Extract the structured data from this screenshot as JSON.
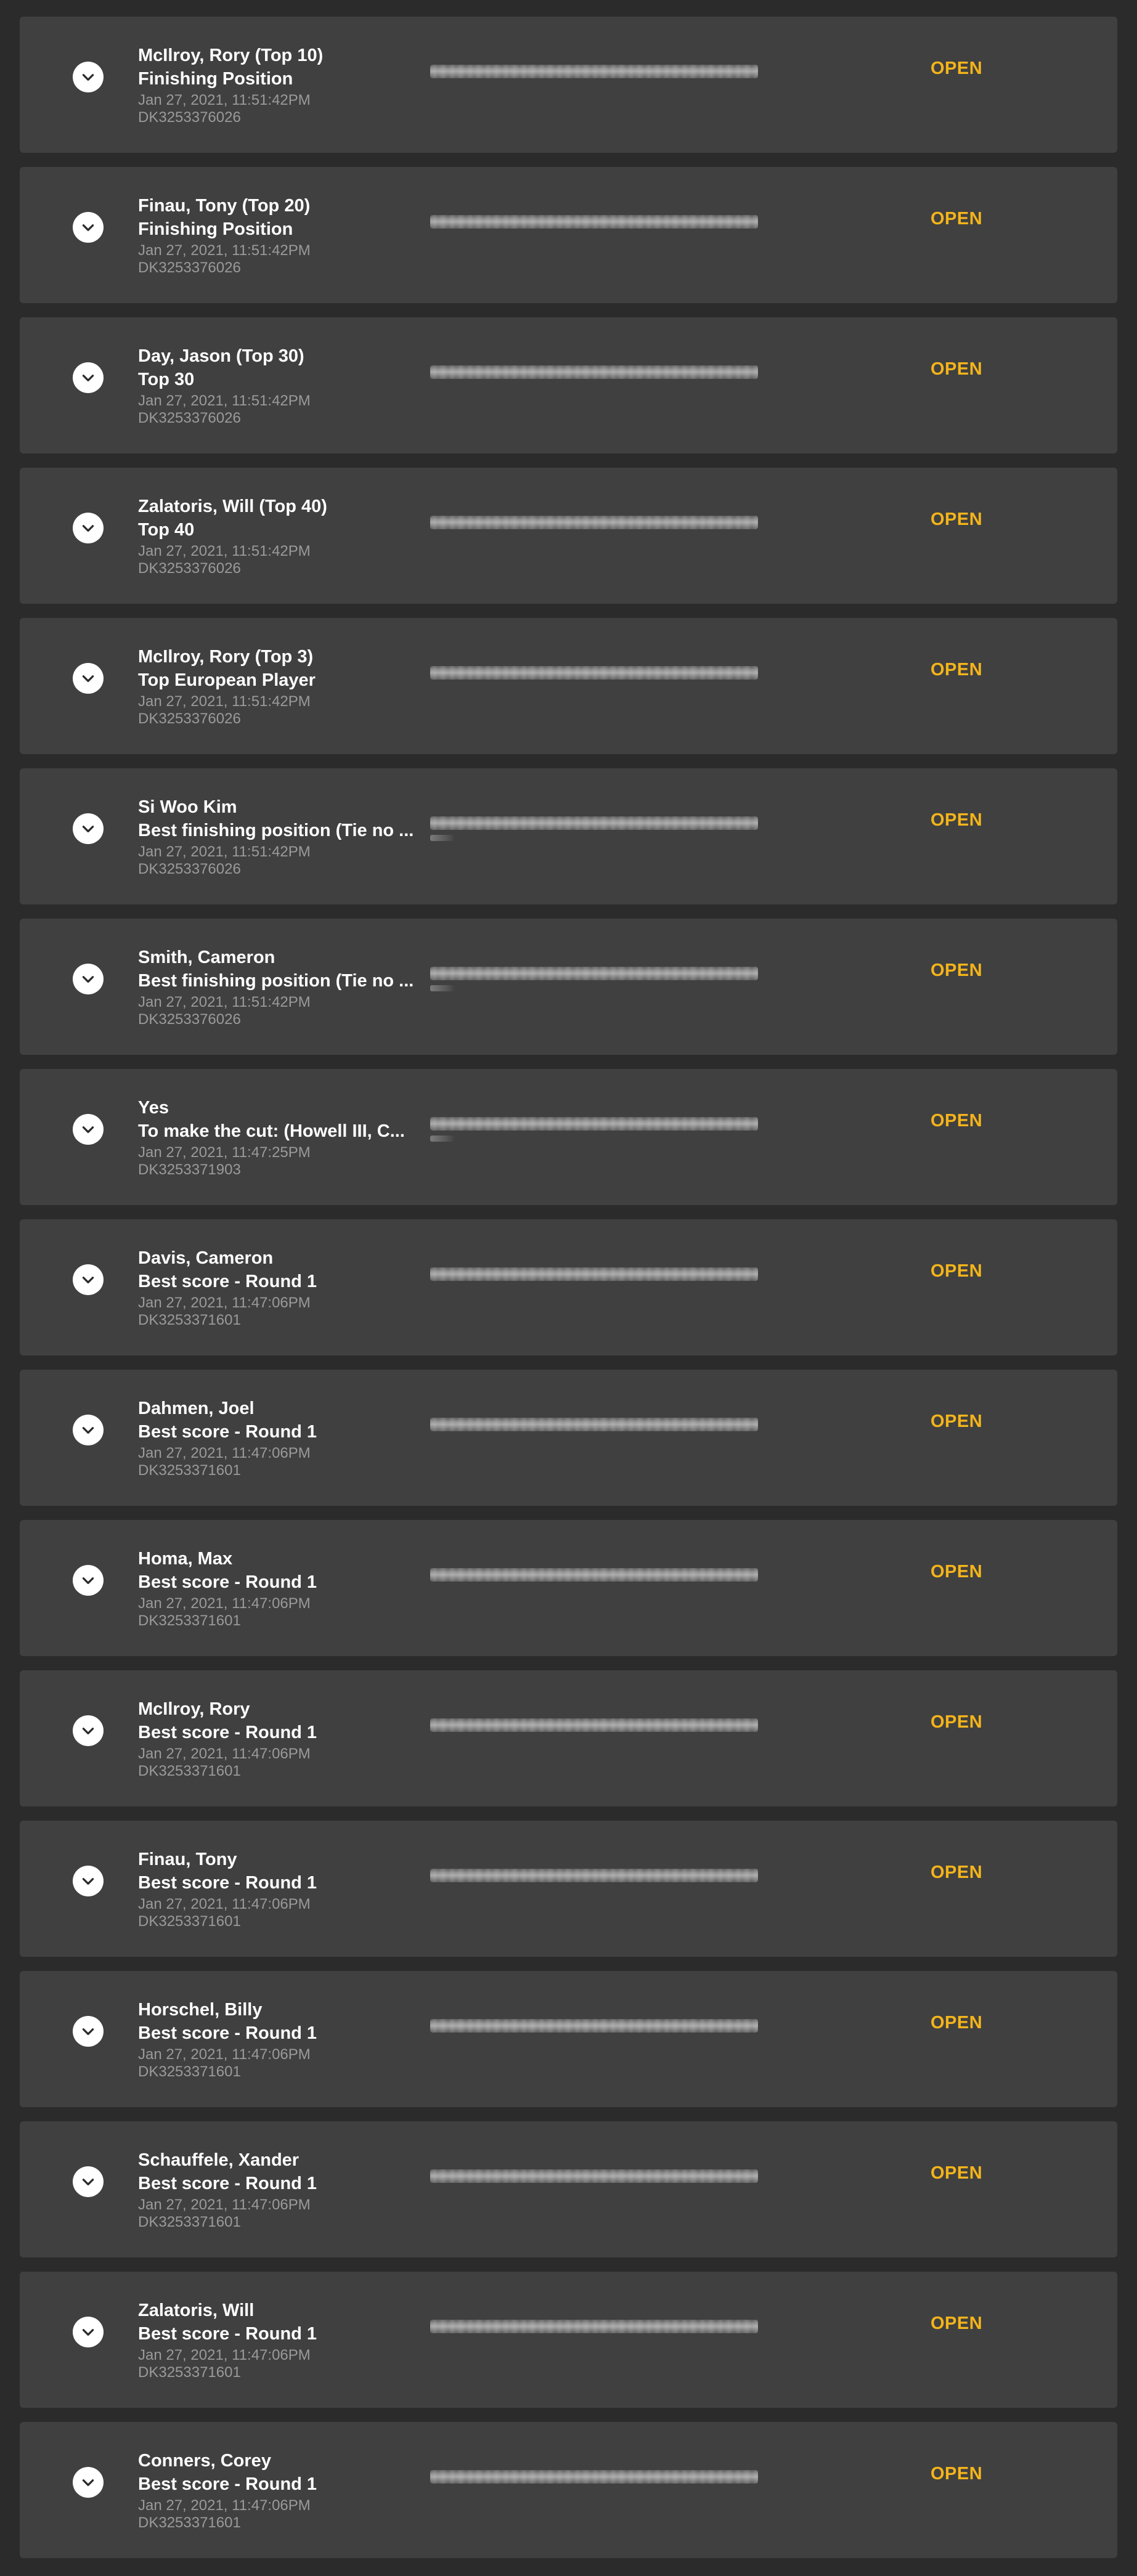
{
  "bets": [
    {
      "selection": "McIlroy, Rory (Top 10)",
      "market": "Finishing Position",
      "timestamp": "Jan 27, 2021, 11:51:42PM",
      "bet_id": "DK3253376026",
      "status": "OPEN",
      "second_line": false
    },
    {
      "selection": "Finau, Tony (Top 20)",
      "market": "Finishing Position",
      "timestamp": "Jan 27, 2021, 11:51:42PM",
      "bet_id": "DK3253376026",
      "status": "OPEN",
      "second_line": false
    },
    {
      "selection": "Day, Jason (Top 30)",
      "market": "Top 30",
      "timestamp": "Jan 27, 2021, 11:51:42PM",
      "bet_id": "DK3253376026",
      "status": "OPEN",
      "second_line": false
    },
    {
      "selection": "Zalatoris, Will (Top 40)",
      "market": "Top 40",
      "timestamp": "Jan 27, 2021, 11:51:42PM",
      "bet_id": "DK3253376026",
      "status": "OPEN",
      "second_line": false
    },
    {
      "selection": "McIlroy, Rory (Top 3)",
      "market": "Top European Player",
      "timestamp": "Jan 27, 2021, 11:51:42PM",
      "bet_id": "DK3253376026",
      "status": "OPEN",
      "second_line": false
    },
    {
      "selection": "Si Woo Kim",
      "market": "Best finishing position (Tie no ...",
      "timestamp": "Jan 27, 2021, 11:51:42PM",
      "bet_id": "DK3253376026",
      "status": "OPEN",
      "second_line": true
    },
    {
      "selection": "Smith, Cameron",
      "market": "Best finishing position (Tie no ...",
      "timestamp": "Jan 27, 2021, 11:51:42PM",
      "bet_id": "DK3253376026",
      "status": "OPEN",
      "second_line": true
    },
    {
      "selection": "Yes",
      "market": "To make the cut: (Howell III, C...",
      "timestamp": "Jan 27, 2021, 11:47:25PM",
      "bet_id": "DK3253371903",
      "status": "OPEN",
      "second_line": true
    },
    {
      "selection": "Davis, Cameron",
      "market": "Best score - Round 1",
      "timestamp": "Jan 27, 2021, 11:47:06PM",
      "bet_id": "DK3253371601",
      "status": "OPEN",
      "second_line": false
    },
    {
      "selection": "Dahmen, Joel",
      "market": "Best score - Round 1",
      "timestamp": "Jan 27, 2021, 11:47:06PM",
      "bet_id": "DK3253371601",
      "status": "OPEN",
      "second_line": false
    },
    {
      "selection": "Homa, Max",
      "market": "Best score - Round 1",
      "timestamp": "Jan 27, 2021, 11:47:06PM",
      "bet_id": "DK3253371601",
      "status": "OPEN",
      "second_line": false
    },
    {
      "selection": "McIlroy, Rory",
      "market": "Best score - Round 1",
      "timestamp": "Jan 27, 2021, 11:47:06PM",
      "bet_id": "DK3253371601",
      "status": "OPEN",
      "second_line": false
    },
    {
      "selection": "Finau, Tony",
      "market": "Best score - Round 1",
      "timestamp": "Jan 27, 2021, 11:47:06PM",
      "bet_id": "DK3253371601",
      "status": "OPEN",
      "second_line": false
    },
    {
      "selection": "Horschel, Billy",
      "market": "Best score - Round 1",
      "timestamp": "Jan 27, 2021, 11:47:06PM",
      "bet_id": "DK3253371601",
      "status": "OPEN",
      "second_line": false
    },
    {
      "selection": "Schauffele, Xander",
      "market": "Best score - Round 1",
      "timestamp": "Jan 27, 2021, 11:47:06PM",
      "bet_id": "DK3253371601",
      "status": "OPEN",
      "second_line": false
    },
    {
      "selection": "Zalatoris, Will",
      "market": "Best score - Round 1",
      "timestamp": "Jan 27, 2021, 11:47:06PM",
      "bet_id": "DK3253371601",
      "status": "OPEN",
      "second_line": false
    },
    {
      "selection": "Conners, Corey",
      "market": "Best score - Round 1",
      "timestamp": "Jan 27, 2021, 11:47:06PM",
      "bet_id": "DK3253371601",
      "status": "OPEN",
      "second_line": false
    }
  ],
  "icons": {
    "toggle": "chevron-down-icon"
  },
  "colors": {
    "background": "#2b2b2b",
    "card": "#404040",
    "status_open": "#f4b41a",
    "meta_text": "#9a9a9a"
  }
}
